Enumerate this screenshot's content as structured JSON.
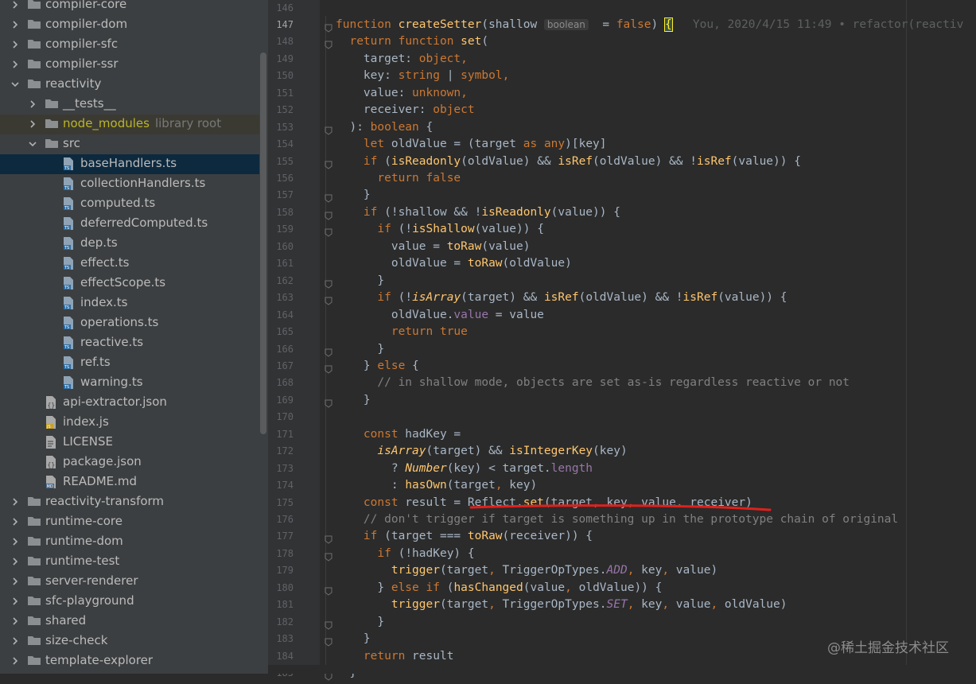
{
  "project_tree": {
    "items": [
      {
        "label": "compiler-core",
        "icon": "folder-icon",
        "arrow": "right"
      },
      {
        "label": "compiler-dom",
        "icon": "folder-icon",
        "arrow": "right"
      },
      {
        "label": "compiler-sfc",
        "icon": "folder-icon",
        "arrow": "right"
      },
      {
        "label": "compiler-ssr",
        "icon": "folder-icon",
        "arrow": "right"
      },
      {
        "label": "reactivity",
        "icon": "folder-icon",
        "arrow": "down"
      },
      {
        "label": "__tests__",
        "icon": "folder-icon",
        "arrow": "right"
      },
      {
        "label": "node_modules",
        "suffix": "library root",
        "icon": "folder-icon",
        "arrow": "right"
      },
      {
        "label": "src",
        "icon": "folder-icon",
        "arrow": "down"
      },
      {
        "label": "baseHandlers.ts",
        "icon": "ts-file-icon"
      },
      {
        "label": "collectionHandlers.ts",
        "icon": "ts-file-icon"
      },
      {
        "label": "computed.ts",
        "icon": "ts-file-icon"
      },
      {
        "label": "deferredComputed.ts",
        "icon": "ts-file-icon"
      },
      {
        "label": "dep.ts",
        "icon": "ts-file-icon"
      },
      {
        "label": "effect.ts",
        "icon": "ts-file-icon"
      },
      {
        "label": "effectScope.ts",
        "icon": "ts-file-icon"
      },
      {
        "label": "index.ts",
        "icon": "ts-file-icon"
      },
      {
        "label": "operations.ts",
        "icon": "ts-file-icon"
      },
      {
        "label": "reactive.ts",
        "icon": "ts-file-icon"
      },
      {
        "label": "ref.ts",
        "icon": "ts-file-icon"
      },
      {
        "label": "warning.ts",
        "icon": "ts-file-icon"
      },
      {
        "label": "api-extractor.json",
        "icon": "json-file-icon"
      },
      {
        "label": "index.js",
        "icon": "js-file-icon"
      },
      {
        "label": "LICENSE",
        "icon": "text-file-icon"
      },
      {
        "label": "package.json",
        "icon": "json-file-icon"
      },
      {
        "label": "README.md",
        "icon": "markdown-file-icon"
      },
      {
        "label": "reactivity-transform",
        "icon": "folder-icon",
        "arrow": "right"
      },
      {
        "label": "runtime-core",
        "icon": "folder-icon",
        "arrow": "right"
      },
      {
        "label": "runtime-dom",
        "icon": "folder-icon",
        "arrow": "right"
      },
      {
        "label": "runtime-test",
        "icon": "folder-icon",
        "arrow": "right"
      },
      {
        "label": "server-renderer",
        "icon": "folder-icon",
        "arrow": "right"
      },
      {
        "label": "sfc-playground",
        "icon": "folder-icon",
        "arrow": "right"
      },
      {
        "label": "shared",
        "icon": "folder-icon",
        "arrow": "right"
      },
      {
        "label": "size-check",
        "icon": "folder-icon",
        "arrow": "right"
      },
      {
        "label": "template-explorer",
        "icon": "folder-icon",
        "arrow": "right"
      }
    ]
  },
  "editor": {
    "first_line": 146,
    "current_line": 147,
    "blame": "You, 2020/4/15 11:49 • refactor(reactiv",
    "param_hint": "boolean",
    "lines": [
      "",
      "function createSetter(shallow = false) {",
      "  return function set(",
      "    target: object,",
      "    key: string | symbol,",
      "    value: unknown,",
      "    receiver: object",
      "  ): boolean {",
      "    let oldValue = (target as any)[key]",
      "    if (isReadonly(oldValue) && isRef(oldValue) && !isRef(value)) {",
      "      return false",
      "    }",
      "    if (!shallow && !isReadonly(value)) {",
      "      if (!isShallow(value)) {",
      "        value = toRaw(value)",
      "        oldValue = toRaw(oldValue)",
      "      }",
      "      if (!isArray(target) && isRef(oldValue) && !isRef(value)) {",
      "        oldValue.value = value",
      "        return true",
      "      }",
      "    } else {",
      "      // in shallow mode, objects are set as-is regardless reactive or not",
      "    }",
      "",
      "    const hadKey =",
      "      isArray(target) && isIntegerKey(key)",
      "        ? Number(key) < target.length",
      "        : hasOwn(target, key)",
      "    const result = Reflect.set(target, key, value, receiver)",
      "    // don't trigger if target is something up in the prototype chain of original",
      "    if (target === toRaw(receiver)) {",
      "      if (!hadKey) {",
      "        trigger(target, TriggerOpTypes.ADD, key, value)",
      "      } else if (hasChanged(value, oldValue)) {",
      "        trigger(target, TriggerOpTypes.SET, key, value, oldValue)",
      "      }",
      "    }",
      "    return result",
      "  }"
    ]
  },
  "watermark": "@稀土掘金技术社区",
  "colors": {
    "tree_bg": "#3c3f41",
    "editor_bg": "#2b2b2b",
    "gutter_bg": "#313335",
    "keyword": "#cc7832",
    "function": "#ffc66d",
    "comment": "#808080",
    "property": "#9876aa",
    "selection": "#0d293e",
    "annotation_red": "#e0201c"
  }
}
